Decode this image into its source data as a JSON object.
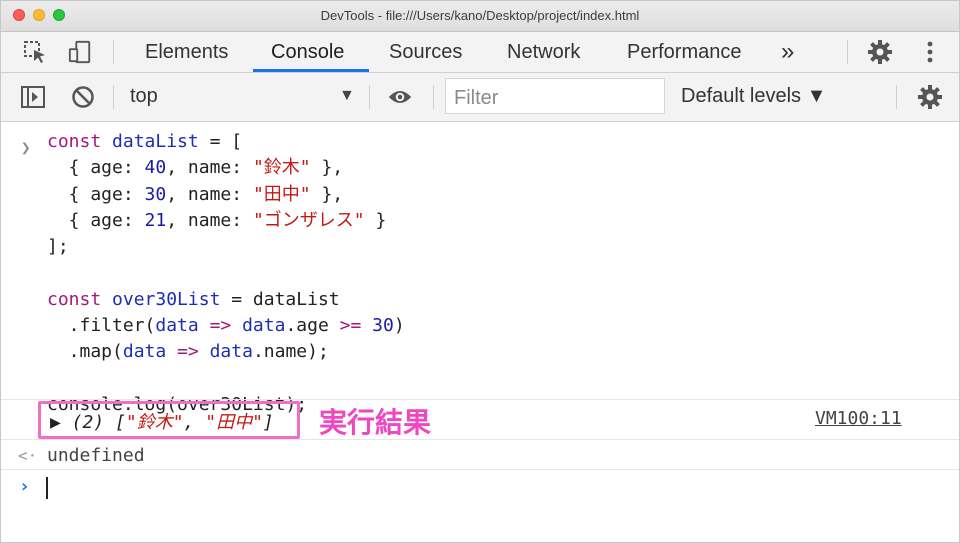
{
  "window": {
    "title": "DevTools - file:///Users/kano/Desktop/project/index.html"
  },
  "tabs": [
    {
      "label": "Elements"
    },
    {
      "label": "Console",
      "active": true
    },
    {
      "label": "Sources"
    },
    {
      "label": "Network"
    },
    {
      "label": "Performance"
    }
  ],
  "more_tabs": "»",
  "toolbar": {
    "context": "top",
    "filter_placeholder": "Filter",
    "levels": "Default levels ▼"
  },
  "code": {
    "l1_kw": "const",
    "l1_var": "dataList",
    "l1_rest": " = [",
    "l2_a": "  { age: ",
    "l2_num": "40",
    "l2_b": ", name: ",
    "l2_str": "\"鈴木\"",
    "l2_c": " },",
    "l3_a": "  { age: ",
    "l3_num": "30",
    "l3_b": ", name: ",
    "l3_str": "\"田中\"",
    "l3_c": " },",
    "l4_a": "  { age: ",
    "l4_num": "21",
    "l4_b": ", name: ",
    "l4_str": "\"ゴンザレス\"",
    "l4_c": " }",
    "l5": "];",
    "l7_kw": "const",
    "l7_var": "over30List",
    "l7_rest": " = dataList",
    "l8_a": "  .filter(",
    "l8_v1": "data",
    "l8_op": " => ",
    "l8_v2": "data",
    "l8_b": ".age ",
    "l8_cmp": ">=",
    "l8_c": " ",
    "l8_num": "30",
    "l8_d": ")",
    "l9_a": "  .map(",
    "l9_v1": "data",
    "l9_op": " => ",
    "l9_v2": "data",
    "l9_b": ".name);",
    "l11": "console.log(over30List);"
  },
  "output": {
    "prefix": "▶ (2) [",
    "item1": "\"鈴木\"",
    "sep": ", ",
    "item2": "\"田中\"",
    "suffix": "]",
    "source": "VM100:11",
    "return_value": "undefined"
  },
  "annotation": "実行結果",
  "colors": {
    "accent": "#1a73e8",
    "annotation": "#ef46c2",
    "string": "#c41a16",
    "keyword": "#a3197d"
  }
}
